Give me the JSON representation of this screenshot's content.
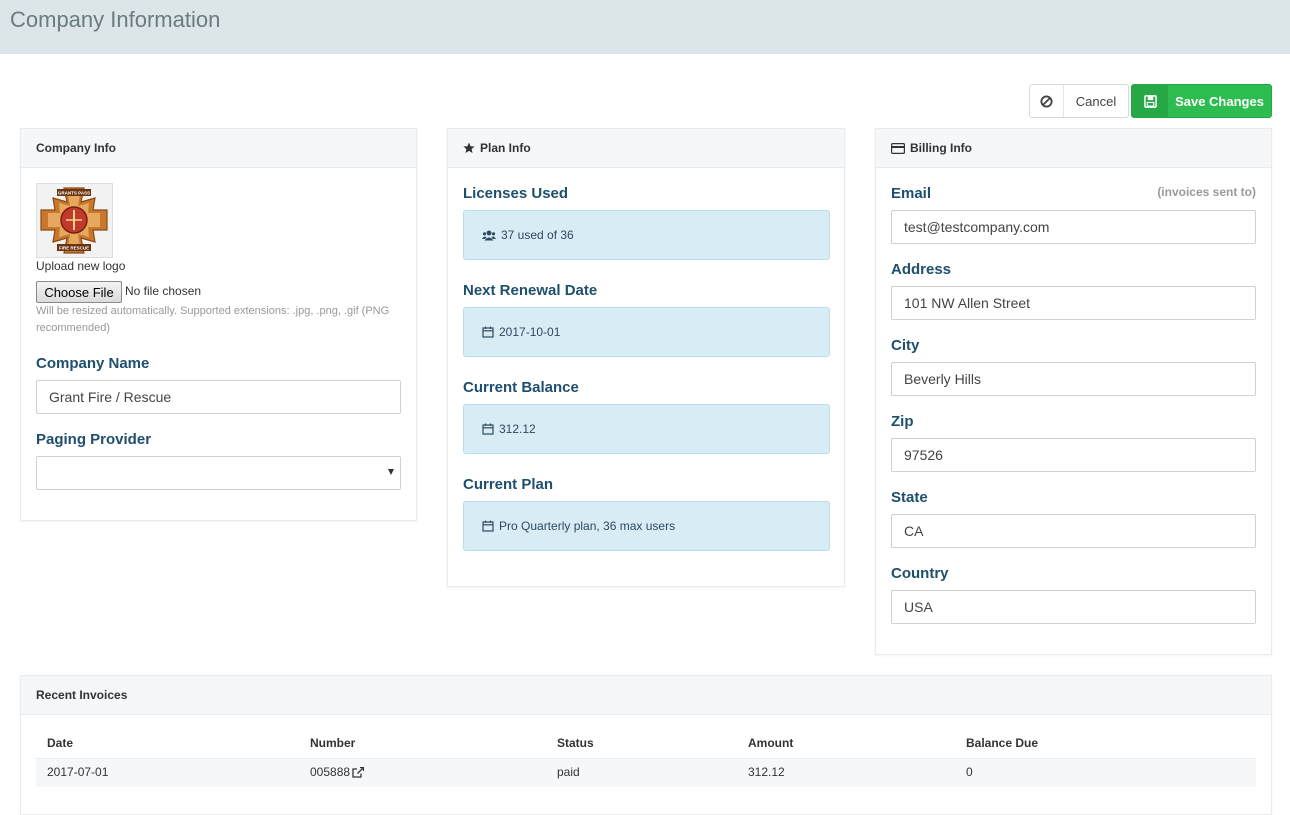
{
  "header": {
    "title": "Company Information"
  },
  "toolbar": {
    "cancel_label": "Cancel",
    "save_label": "Save Changes"
  },
  "company_info": {
    "panel_title": "Company Info",
    "upload_label": "Upload new logo",
    "choose_file_label": "Choose File",
    "no_file_text": "No file chosen",
    "hint": "Will be resized automatically. Supported extensions: .jpg, .png, .gif (PNG recommended)",
    "company_name_label": "Company Name",
    "company_name_value": "Grant Fire / Rescue",
    "paging_provider_label": "Paging Provider",
    "paging_provider_value": "",
    "logo_text_top": "GRANTS PASS",
    "logo_text_bottom": "FIRE RESCUE"
  },
  "plan_info": {
    "panel_title": "Plan Info",
    "licenses_label": "Licenses Used",
    "licenses_value": "37 used of 36",
    "renewal_label": "Next Renewal Date",
    "renewal_value": "2017-10-01",
    "balance_label": "Current Balance",
    "balance_value": "312.12",
    "plan_label": "Current Plan",
    "plan_value": "Pro Quarterly plan, 36 max users"
  },
  "billing_info": {
    "panel_title": "Billing Info",
    "email_label": "Email",
    "email_note": "(invoices sent to)",
    "email_value": "test@testcompany.com",
    "address_label": "Address",
    "address_value": "101 NW Allen Street",
    "city_label": "City",
    "city_value": "Beverly Hills",
    "zip_label": "Zip",
    "zip_value": "97526",
    "state_label": "State",
    "state_value": "CA",
    "country_label": "Country",
    "country_value": "USA"
  },
  "invoices": {
    "panel_title": "Recent Invoices",
    "columns": [
      "Date",
      "Number",
      "Status",
      "Amount",
      "Balance Due"
    ],
    "rows": [
      {
        "date": "2017-07-01",
        "number": "005888",
        "status": "paid",
        "amount": "312.12",
        "balance_due": "0"
      }
    ]
  },
  "colors": {
    "accent_green": "#2cbc4f",
    "label_blue": "#1e4f6d",
    "well_blue": "#d8ecf5",
    "header_bg": "#dce5e8"
  }
}
